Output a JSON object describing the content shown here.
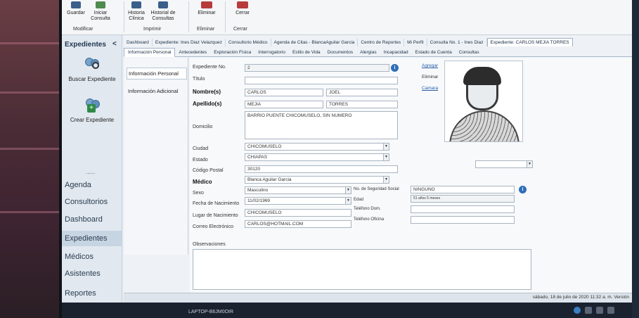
{
  "ribbon": {
    "buttons": [
      "Guardar",
      "Iniciar Consulta",
      "Historia Clínica",
      "Historial de Consultas",
      "Eliminar",
      "Cerrar"
    ],
    "groups": [
      "Modificar",
      "Imprimir",
      "Eliminar",
      "Cerrar"
    ]
  },
  "nav": {
    "title": "Expedientes",
    "collapse": "<",
    "tools": [
      "Buscar Expediente",
      "Crear Expediente"
    ],
    "dots": "......",
    "items": [
      "Agenda",
      "Consultorios",
      "Dashboard",
      "Expedientes",
      "Médicos",
      "Asistentes",
      "Reportes"
    ],
    "active_item": "Expedientes",
    "more": "..."
  },
  "tabs_top": [
    "Dashboard",
    "Expediente: Ines Diaz Velazquez",
    "Consultorio Médico",
    "Agenda de Citas - BlancaAguilar Garcia",
    "Centro de Reportes",
    "Mi Perfil",
    "Consulta No. 1 - Ines Diaz",
    "Expediente: CARLOS MEJIA TORRES"
  ],
  "tabs_sub": [
    "Información Personal",
    "Antecedentes",
    "Exploración Física",
    "Interrogatorio",
    "Estilo de Vida",
    "Documentos",
    "Alergias",
    "Incapacidad",
    "Estado de Cuenta",
    "Consultas"
  ],
  "side_sections": [
    "Información Personal",
    "Información Adicional"
  ],
  "form": {
    "expediente_label": "Expediente No.",
    "expediente_value": "2",
    "titulo_label": "Título",
    "nombre_label": "Nombre(s)",
    "nombre1": "CARLOS",
    "nombre2": "JOEL",
    "apellido_label": "Apellido(s)",
    "apellido1": "MEJIA",
    "apellido2": "TORRES",
    "domicilio_label": "Domicilio",
    "domicilio_value": "BARRIO PUENTE CHICOMUSELO, SIN NUMERO",
    "ciudad_label": "Ciudad",
    "ciudad_value": "CHICOMUSELO",
    "estado_label": "Estado",
    "estado_value": "CHIAPAS",
    "cp_label": "Código Postal",
    "cp_value": "30120",
    "medico_label": "Médico",
    "medico_value": "Blanca Aguilar Garcia",
    "sexo_label": "Sexo",
    "sexo_value": "Masculino",
    "nss_label": "No. de Seguridad Social",
    "nss_value": "NINGUNO",
    "fecha_label": "Fecha de Nacimiento",
    "fecha_value": "11/02/1969",
    "edad_label": "Edad",
    "edad_value": "51 años 5 meses",
    "lugar_label": "Lugar de Nacimiento",
    "lugar_value": "CHICOMUSELO",
    "tel_dom_label": "Teléfono Dom.",
    "correo_label": "Correo Electrónico",
    "correo_value": "CARLOS@HOTMAIL.COM",
    "tel_ofi_label": "Teléfono Oficina",
    "obs_label": "Observaciones"
  },
  "photo_actions": {
    "agregar": "Agregar",
    "eliminar": "Eliminar",
    "camara": "Camara"
  },
  "status": {
    "datetime": "sábado, 18 de julio de 2020 11:32 a. m.   Versión"
  },
  "taskbar": {
    "text": "LAPTOP-B6JM0OIR"
  },
  "colors": {
    "accent": "#2f6fb8",
    "nav_bg": "#e1e8ef",
    "link": "#2a5fa8"
  }
}
